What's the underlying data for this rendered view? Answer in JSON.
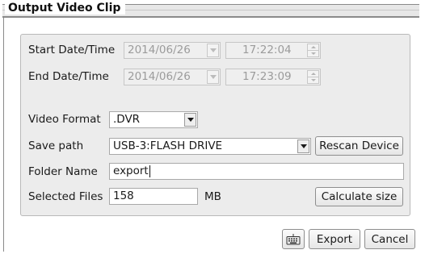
{
  "window": {
    "title": "Output Video Clip"
  },
  "form": {
    "start": {
      "label": "Start Date/Time",
      "date": "2014/06/26",
      "time": "17:22:04"
    },
    "end": {
      "label": "End Date/Time",
      "date": "2014/06/26",
      "time": "17:23:09"
    },
    "video_format": {
      "label": "Video Format",
      "value": ".DVR"
    },
    "save_path": {
      "label": "Save path",
      "value": "USB-3:FLASH DRIVE",
      "rescan_label": "Rescan Device"
    },
    "folder_name": {
      "label": "Folder Name",
      "value": "export"
    },
    "selected_files": {
      "label": "Selected Files",
      "value": "158",
      "unit": "MB",
      "calc_label": "Calculate size"
    }
  },
  "footer": {
    "keyboard_icon": "keyboard-icon",
    "export_label": "Export",
    "cancel_label": "Cancel"
  }
}
